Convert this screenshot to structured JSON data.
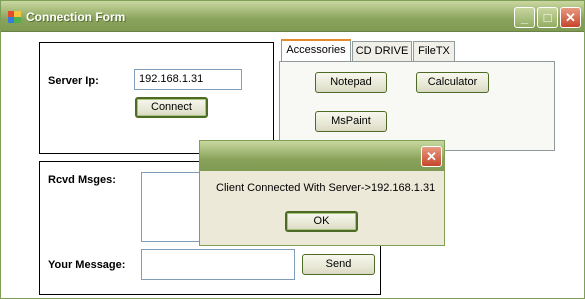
{
  "window": {
    "title": "Connection Form",
    "minimize_glyph": "_",
    "maximize_glyph": "□",
    "close_glyph": "✕"
  },
  "connection": {
    "server_ip_label": "Server Ip:",
    "server_ip_value": "192.168.1.31",
    "connect_label": "Connect"
  },
  "tabs": [
    {
      "label": "Accessories",
      "active": true
    },
    {
      "label": "CD DRIVE",
      "active": false
    },
    {
      "label": "FileTX",
      "active": false
    }
  ],
  "accessories": {
    "notepad_label": "Notepad",
    "calculator_label": "Calculator",
    "mspaint_label": "MsPaint"
  },
  "chat": {
    "received_label": "Rcvd Msges:",
    "received_value": "",
    "your_message_label": "Your Message:",
    "your_message_value": "",
    "send_label": "Send"
  },
  "dialog": {
    "message": "Client Connected With Server->192.168.1.31",
    "ok_label": "OK",
    "close_glyph": "✕"
  },
  "colors": {
    "titlebar": "#8aa35b",
    "button_border": "#4d6b24",
    "close_button": "#c7462b",
    "active_tab_accent": "#e68b2c"
  }
}
